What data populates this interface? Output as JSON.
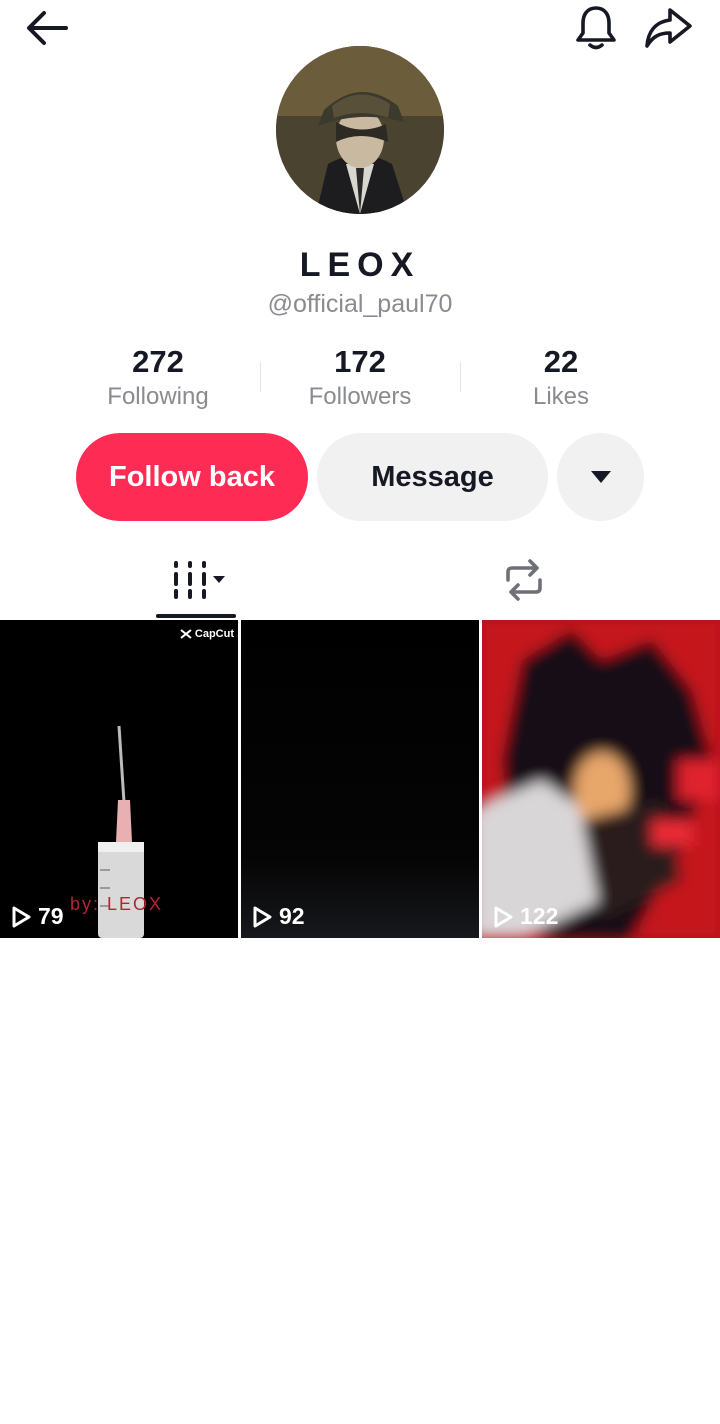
{
  "profile": {
    "display_name": "LEOX",
    "handle": "@official_paul70"
  },
  "stats": {
    "following": {
      "value": "272",
      "label": "Following"
    },
    "followers": {
      "value": "172",
      "label": "Followers"
    },
    "likes": {
      "value": "22",
      "label": "Likes"
    }
  },
  "actions": {
    "follow_back": "Follow back",
    "message": "Message"
  },
  "tabs": [
    {
      "name": "videos",
      "icon": "grid-columns-icon",
      "active": true
    },
    {
      "name": "reposts",
      "icon": "repost-icon",
      "active": false
    }
  ],
  "videos": [
    {
      "views": "79",
      "badge": "CapCut",
      "watermark": "by: LEOX"
    },
    {
      "views": "92"
    },
    {
      "views": "122"
    }
  ],
  "icons": {
    "back": "arrow-left-icon",
    "notifications": "bell-icon",
    "share": "share-arrow-icon",
    "more": "caret-down-icon"
  },
  "colors": {
    "accent": "#fe2c55",
    "secondary_button": "#f1f1f2",
    "muted_text": "#8a8b91"
  }
}
